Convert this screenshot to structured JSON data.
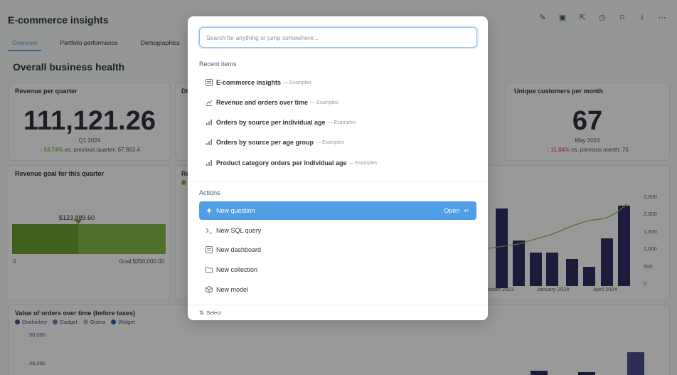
{
  "dashboard": {
    "title": "E-commerce insights",
    "tabs": [
      "Overview",
      "Portfolio performance",
      "Demographics"
    ],
    "section_title": "Overall business health",
    "revenue_card": {
      "title": "Revenue per quarter",
      "value": "111,121.26",
      "period": "Q1 2024",
      "delta": "63.74%",
      "comparison": "vs. previous quarter: 67,863.4"
    },
    "partial_card_title": "Di",
    "customers_card": {
      "title": "Unique customers per month",
      "value": "67",
      "period": "May 2024",
      "delta": "11.84%",
      "comparison": "vs. previous month: 76"
    },
    "goal_card": {
      "title": "Revenue goal for this quarter",
      "progress_fraction": 0.43,
      "marker_value": "$123,889.60",
      "min_label": "0",
      "goal_label": "Goal $250,000.00"
    },
    "partial_chart_title": "Re",
    "bar_chart": {
      "y_ticks": [
        "2,500",
        "2,000",
        "1,500",
        "1,000",
        "500",
        "0"
      ],
      "x_ticks": [
        "ctober 2023",
        "January 2024",
        "April 2024"
      ]
    },
    "orders_chart": {
      "title": "Value of orders over time (before taxes)",
      "legend": [
        "Doohickey",
        "Gadget",
        "Gizmo",
        "Widget"
      ],
      "y_ticks": [
        "50,000",
        "40,000"
      ]
    },
    "colors": {
      "accent": "#509ee3",
      "bar": "#2f3061",
      "line": "#84bb4c",
      "doohickey": "#4b4d8c",
      "gadget": "#7b78b4",
      "gizmo": "#a9c8c0",
      "widget": "#2a5ca8"
    }
  },
  "palette": {
    "search_placeholder": "Search for anything or jump somewhere...",
    "recent_label": "Recent items",
    "recent_items": [
      {
        "name": "E-commerce insights",
        "sub": "— Examples",
        "icon": "dashboard-icon"
      },
      {
        "name": "Revenue and orders over time",
        "sub": "— Examples",
        "icon": "line-chart-icon"
      },
      {
        "name": "Orders by source per individual age",
        "sub": "— Examples",
        "icon": "bar-chart-icon"
      },
      {
        "name": "Orders by source per age group",
        "sub": "— Examples",
        "icon": "bar-chart-icon"
      },
      {
        "name": "Product category orders per individual age",
        "sub": "— Examples",
        "icon": "bar-chart-icon"
      }
    ],
    "actions_label": "Actions",
    "actions": [
      {
        "name": "New question",
        "icon": "insight-icon"
      },
      {
        "name": "New SQL query",
        "icon": "sql-icon"
      },
      {
        "name": "New dashboard",
        "icon": "dashboard-icon"
      },
      {
        "name": "New collection",
        "icon": "folder-icon"
      },
      {
        "name": "New model",
        "icon": "model-icon"
      }
    ],
    "open_label": "Open",
    "footer_label": "Select"
  }
}
